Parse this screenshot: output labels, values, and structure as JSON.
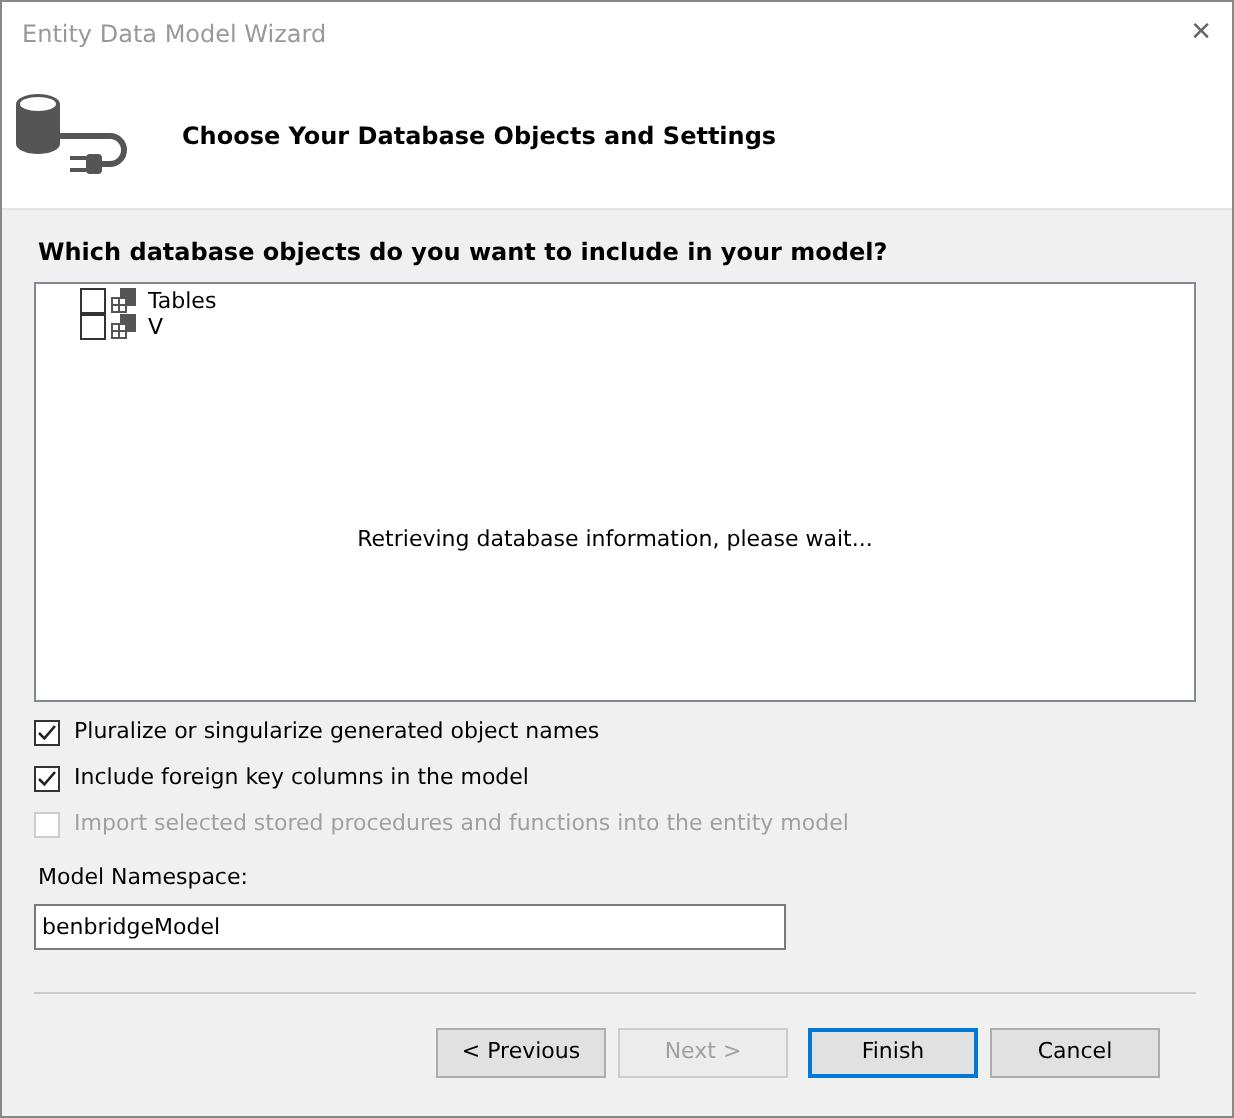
{
  "window": {
    "title": "Entity Data Model Wizard",
    "close": "✕"
  },
  "header": {
    "title": "Choose Your Database Objects and Settings"
  },
  "question": "Which database objects do you want to include in your model?",
  "tree": [
    {
      "label": "Tables",
      "checked": false
    },
    {
      "label": "V",
      "checked": false
    }
  ],
  "status": "Retrieving database information, please wait...",
  "options": [
    {
      "label": "Pluralize or singularize generated object names",
      "checked": true,
      "disabled": false
    },
    {
      "label": "Include foreign key columns in the model",
      "checked": true,
      "disabled": false
    },
    {
      "label": "Import selected stored procedures and functions into the entity model",
      "checked": false,
      "disabled": true
    }
  ],
  "namespace": {
    "label": "Model Namespace:",
    "value": "benbridgeModel"
  },
  "buttons": [
    {
      "label": "< Previous",
      "disabled": false,
      "default": false
    },
    {
      "label": "Next >",
      "disabled": true,
      "default": false
    },
    {
      "label": "Finish",
      "disabled": false,
      "default": true
    },
    {
      "label": "Cancel",
      "disabled": false,
      "default": false
    }
  ]
}
